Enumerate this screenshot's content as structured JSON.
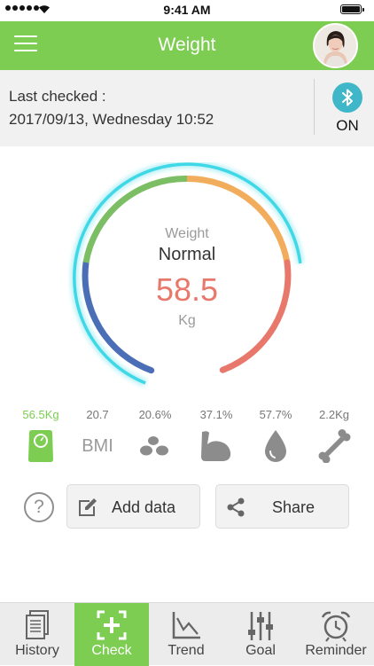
{
  "status_bar": {
    "time": "9:41 AM"
  },
  "header": {
    "title": "Weight"
  },
  "check_info": {
    "label": "Last checked :",
    "date": "2017/09/13, Wednesday 10:52",
    "bluetooth_state": "ON"
  },
  "gauge": {
    "caption": "Weight",
    "status": "Normal",
    "value": "58.5",
    "unit": "Kg"
  },
  "metrics": [
    {
      "value": "56.5Kg",
      "icon": "scale-icon",
      "active": true
    },
    {
      "value": "20.7",
      "label": "BMI",
      "icon": "bmi-text"
    },
    {
      "value": "20.6%",
      "icon": "fat-cells-icon"
    },
    {
      "value": "37.1%",
      "icon": "muscle-arm-icon"
    },
    {
      "value": "57.7%",
      "icon": "water-drop-icon"
    },
    {
      "value": "2.2Kg",
      "icon": "bone-icon"
    }
  ],
  "actions": {
    "help": "?",
    "add_data": "Add data",
    "share": "Share"
  },
  "tabs": [
    {
      "label": "History",
      "icon": "history-icon"
    },
    {
      "label": "Check",
      "icon": "check-scan-icon",
      "active": true
    },
    {
      "label": "Trend",
      "icon": "trend-chart-icon"
    },
    {
      "label": "Goal",
      "icon": "sliders-icon"
    },
    {
      "label": "Reminder",
      "icon": "alarm-clock-icon"
    }
  ],
  "colors": {
    "primary_green": "#7ccd51",
    "gauge_value": "#e8786b",
    "gauge_glow": "#3fd8e6",
    "segment_blue": "#4a6fb6",
    "segment_green": "#7cbe63",
    "segment_orange": "#f2ad5c",
    "segment_red": "#e8786b",
    "bluetooth": "#3fb7c8"
  }
}
